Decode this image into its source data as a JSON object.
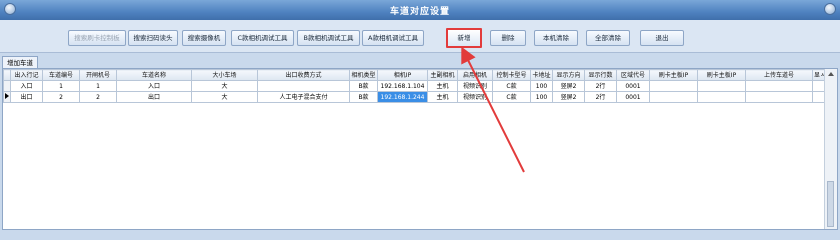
{
  "window": {
    "title": "车道对应设置"
  },
  "toolbar": {
    "buttons": [
      {
        "label": "搜索刷卡控制板",
        "disabled": true
      },
      {
        "label": "搜索扫码读头",
        "disabled": false
      },
      {
        "label": "搜索摄像机",
        "disabled": false
      },
      {
        "label": "C款相机调试工具",
        "disabled": false
      },
      {
        "label": "B款相机调试工具",
        "disabled": false
      },
      {
        "label": "A款相机调试工具",
        "disabled": false
      },
      {
        "label": "新增",
        "disabled": false,
        "highlighted": true
      },
      {
        "label": "删除",
        "disabled": false
      },
      {
        "label": "本机清除",
        "disabled": false
      },
      {
        "label": "全部清除",
        "disabled": false
      },
      {
        "label": "退出",
        "disabled": false
      }
    ]
  },
  "tab": {
    "label": "增加车道"
  },
  "grid": {
    "columns": [
      "出入行记",
      "车道编号",
      "开闸机号",
      "车道名称",
      "大小车场",
      "出口收费方式",
      "相机类型",
      "相机IP",
      "主副相机",
      "启用相机",
      "控制卡型号",
      "卡地址",
      "显示方向",
      "显示行数",
      "区域代号",
      "刷卡主板IP",
      "刷卡主板IP",
      "上传车道号",
      "显ㅅ"
    ],
    "rows": [
      [
        "入口",
        "1",
        "1",
        "入口",
        "大",
        "",
        "B款",
        "192.168.1.104",
        "主机",
        "视频识别",
        "C款",
        "100",
        "竖屏2",
        "2行",
        "0001",
        "",
        "",
        "",
        ""
      ],
      [
        "出口",
        "2",
        "2",
        "出口",
        "大",
        "人工电子混合支付",
        "B款",
        "192.168.1.244",
        "主机",
        "视频识别",
        "C款",
        "100",
        "竖屏2",
        "2行",
        "0001",
        "",
        "",
        "",
        ""
      ]
    ],
    "current_row_index": 1,
    "selected_cell": "相机IP"
  },
  "colors": {
    "highlight_border": "#e23b3b",
    "selection": "#3a8ee6",
    "titlebar": "#4f82c0"
  }
}
